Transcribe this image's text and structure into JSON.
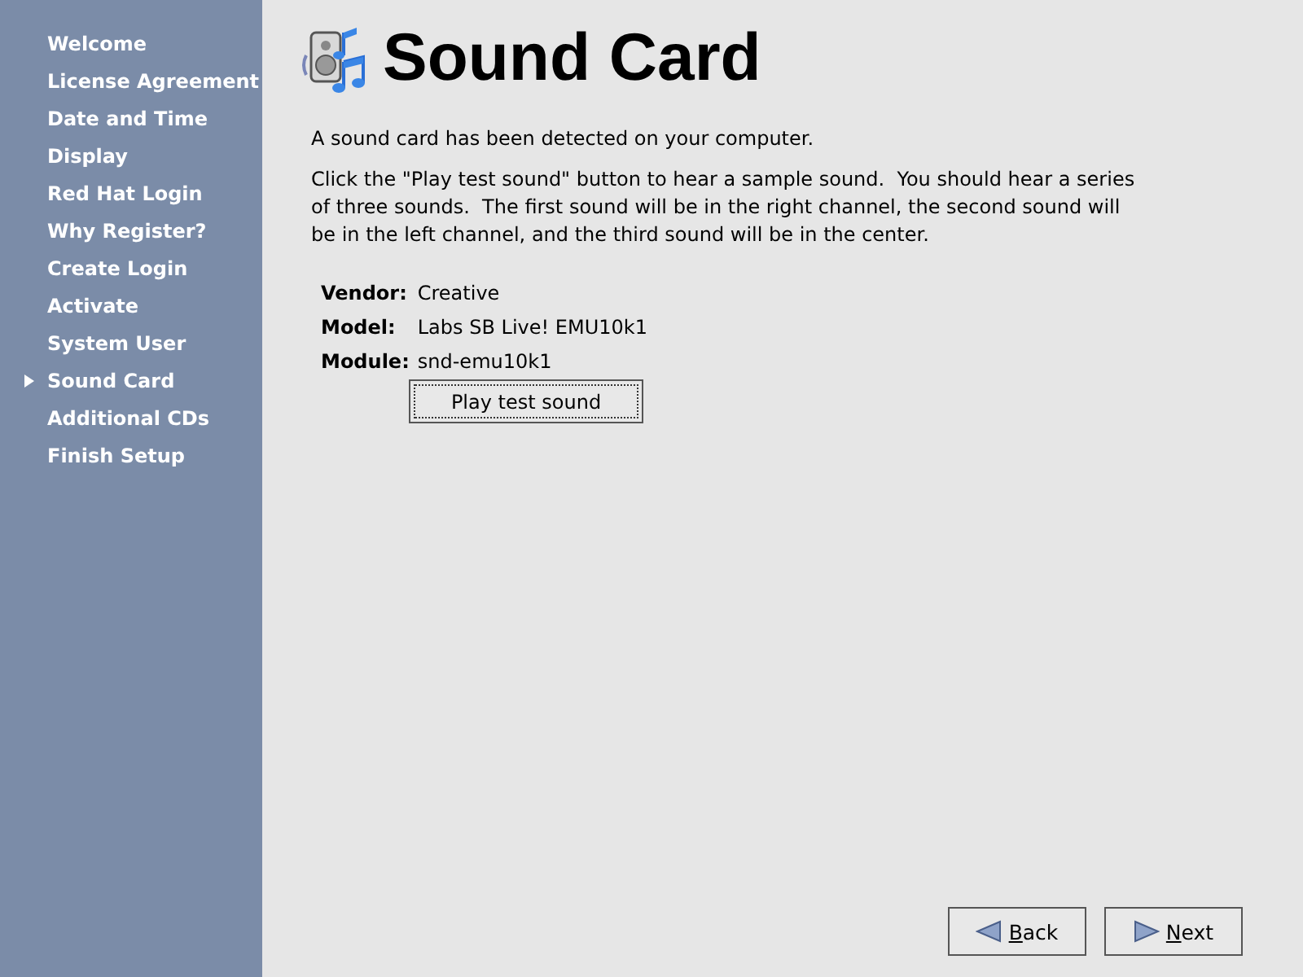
{
  "sidebar": {
    "items": [
      {
        "label": "Welcome",
        "selected": false
      },
      {
        "label": "License Agreement",
        "selected": false
      },
      {
        "label": "Date and Time",
        "selected": false
      },
      {
        "label": "Display",
        "selected": false
      },
      {
        "label": "Red Hat Login",
        "selected": false
      },
      {
        "label": "Why Register?",
        "selected": false
      },
      {
        "label": "Create Login",
        "selected": false
      },
      {
        "label": "Activate",
        "selected": false
      },
      {
        "label": "System User",
        "selected": false
      },
      {
        "label": "Sound Card",
        "selected": true
      },
      {
        "label": "Additional CDs",
        "selected": false
      },
      {
        "label": "Finish Setup",
        "selected": false
      }
    ]
  },
  "page": {
    "title": "Sound Card",
    "paragraphs": [
      "A sound card has been detected on your computer.",
      "Click the \"Play test sound\" button to hear a sample sound.  You should hear a series of three sounds.  The first sound will be in the right channel, the second sound will be in the left channel, and the third sound will be in the center."
    ],
    "details": [
      {
        "label": "Vendor:",
        "value": "Creative"
      },
      {
        "label": "Model:",
        "value": "Labs SB Live! EMU10k1"
      },
      {
        "label": "Module:",
        "value": "snd-emu10k1"
      }
    ],
    "test_button": {
      "label": "Play test sound",
      "focused": true
    }
  },
  "nav_buttons": [
    {
      "label": "Back",
      "kind": "back",
      "mnemonic": true
    },
    {
      "label": "Next",
      "kind": "next",
      "mnemonic": true
    }
  ]
}
